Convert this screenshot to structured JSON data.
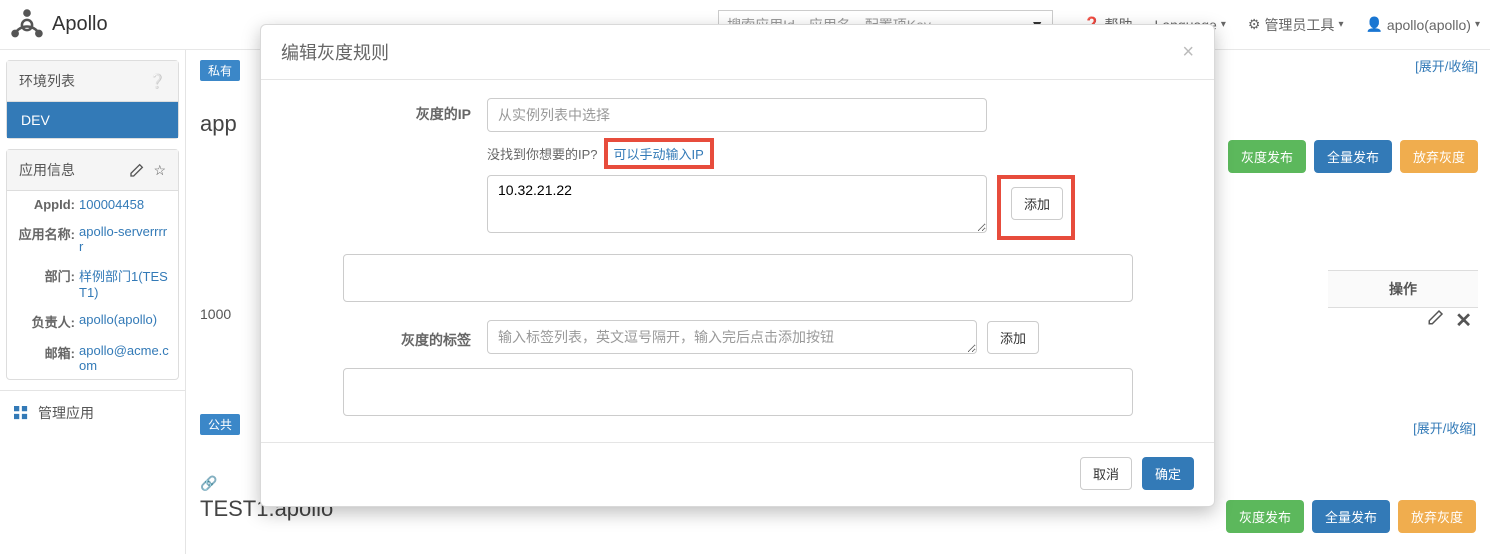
{
  "navbar": {
    "brand": "Apollo",
    "search_placeholder": "搜索应用Id、应用名、配置项Key",
    "help": "帮助",
    "language": "Language",
    "admin_tools": "管理员工具",
    "user": "apollo(apollo)"
  },
  "sidebar": {
    "env_title": "环境列表",
    "env_item": "DEV",
    "appinfo_title": "应用信息",
    "rows": [
      {
        "k": "AppId:",
        "v": "100004458"
      },
      {
        "k": "应用名称:",
        "v": "apollo-serverrrrr"
      },
      {
        "k": "部门:",
        "v": "样例部门1(TEST1)"
      },
      {
        "k": "负责人:",
        "v": "apollo(apollo)"
      },
      {
        "k": "邮箱:",
        "v": "apollo@acme.com"
      }
    ],
    "manage_app": "管理应用"
  },
  "main": {
    "badge_private": "私有",
    "badge_public": "公共",
    "ns_title_prefix": "app",
    "ns_title2": "TEST1.apollo",
    "expand": "[展开/收缩]",
    "gray_publish": "灰度发布",
    "full_publish": "全量发布",
    "abandon_gray": "放弃灰度",
    "ops_header": "操作",
    "row_id": "1000"
  },
  "modal": {
    "title": "编辑灰度规则",
    "ip_label": "灰度的IP",
    "ip_select_placeholder": "从实例列表中选择",
    "ip_hint_q": "没找到你想要的IP?",
    "ip_hint_link": "可以手动输入IP",
    "ip_textarea_value": "10.32.21.22",
    "add_btn": "添加",
    "tag_label": "灰度的标签",
    "tag_placeholder": "输入标签列表，英文逗号隔开，输入完后点击添加按钮",
    "cancel": "取消",
    "ok": "确定"
  }
}
